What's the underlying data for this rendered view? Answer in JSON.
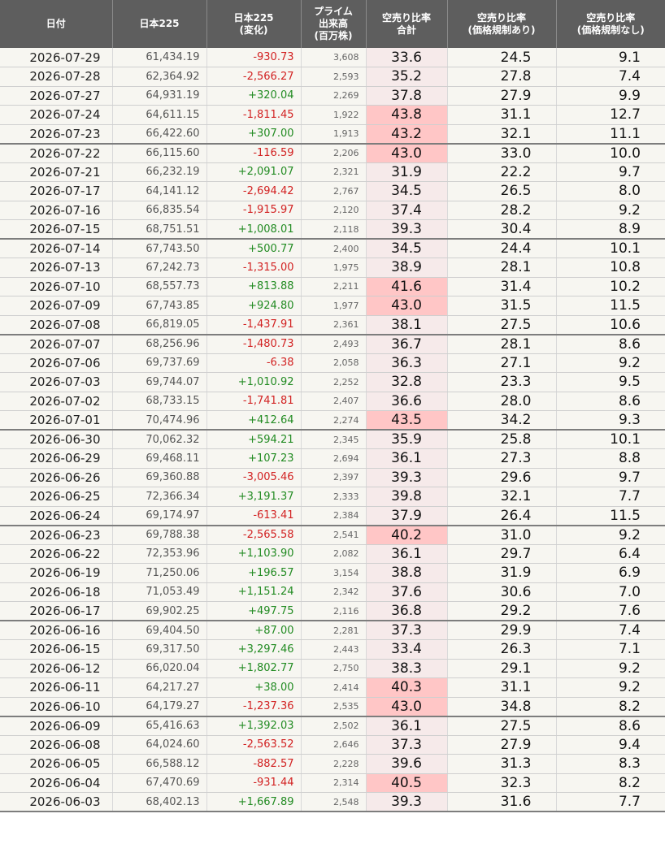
{
  "header": {
    "date": "日付",
    "nikkei": "日本225",
    "change": [
      "日本225",
      "(変化)"
    ],
    "volume": [
      "プライム",
      "出来高",
      "(百万株)"
    ],
    "ratio_total": [
      "空売り比率",
      "合計"
    ],
    "ratio_reg": [
      "空売り比率",
      "(価格規制あり)"
    ],
    "ratio_noreg": [
      "空売り比率",
      "(価格規制なし)"
    ]
  },
  "colors": {
    "negative": "#d22222",
    "positive": "#228b22",
    "highlight": "#ffc6c6",
    "header_bg": "#5e5e5e"
  },
  "highlight_threshold": 40,
  "rows": [
    {
      "date": "2026-07-29",
      "nikkei": "61,434.19",
      "change": "-930.73",
      "volume": "3,608",
      "total": "33.6",
      "reg": "24.5",
      "noreg": "9.1"
    },
    {
      "date": "2026-07-28",
      "nikkei": "62,364.92",
      "change": "-2,566.27",
      "volume": "2,593",
      "total": "35.2",
      "reg": "27.8",
      "noreg": "7.4"
    },
    {
      "date": "2026-07-27",
      "nikkei": "64,931.19",
      "change": "+320.04",
      "volume": "2,269",
      "total": "37.8",
      "reg": "27.9",
      "noreg": "9.9"
    },
    {
      "date": "2026-07-24",
      "nikkei": "64,611.15",
      "change": "-1,811.45",
      "volume": "1,922",
      "total": "43.8",
      "reg": "31.1",
      "noreg": "12.7"
    },
    {
      "date": "2026-07-23",
      "nikkei": "66,422.60",
      "change": "+307.00",
      "volume": "1,913",
      "total": "43.2",
      "reg": "32.1",
      "noreg": "11.1"
    },
    {
      "date": "2026-07-22",
      "nikkei": "66,115.60",
      "change": "-116.59",
      "volume": "2,206",
      "total": "43.0",
      "reg": "33.0",
      "noreg": "10.0"
    },
    {
      "date": "2026-07-21",
      "nikkei": "66,232.19",
      "change": "+2,091.07",
      "volume": "2,321",
      "total": "31.9",
      "reg": "22.2",
      "noreg": "9.7"
    },
    {
      "date": "2026-07-17",
      "nikkei": "64,141.12",
      "change": "-2,694.42",
      "volume": "2,767",
      "total": "34.5",
      "reg": "26.5",
      "noreg": "8.0"
    },
    {
      "date": "2026-07-16",
      "nikkei": "66,835.54",
      "change": "-1,915.97",
      "volume": "2,120",
      "total": "37.4",
      "reg": "28.2",
      "noreg": "9.2"
    },
    {
      "date": "2026-07-15",
      "nikkei": "68,751.51",
      "change": "+1,008.01",
      "volume": "2,118",
      "total": "39.3",
      "reg": "30.4",
      "noreg": "8.9"
    },
    {
      "date": "2026-07-14",
      "nikkei": "67,743.50",
      "change": "+500.77",
      "volume": "2,400",
      "total": "34.5",
      "reg": "24.4",
      "noreg": "10.1"
    },
    {
      "date": "2026-07-13",
      "nikkei": "67,242.73",
      "change": "-1,315.00",
      "volume": "1,975",
      "total": "38.9",
      "reg": "28.1",
      "noreg": "10.8"
    },
    {
      "date": "2026-07-10",
      "nikkei": "68,557.73",
      "change": "+813.88",
      "volume": "2,211",
      "total": "41.6",
      "reg": "31.4",
      "noreg": "10.2"
    },
    {
      "date": "2026-07-09",
      "nikkei": "67,743.85",
      "change": "+924.80",
      "volume": "1,977",
      "total": "43.0",
      "reg": "31.5",
      "noreg": "11.5"
    },
    {
      "date": "2026-07-08",
      "nikkei": "66,819.05",
      "change": "-1,437.91",
      "volume": "2,361",
      "total": "38.1",
      "reg": "27.5",
      "noreg": "10.6"
    },
    {
      "date": "2026-07-07",
      "nikkei": "68,256.96",
      "change": "-1,480.73",
      "volume": "2,493",
      "total": "36.7",
      "reg": "28.1",
      "noreg": "8.6"
    },
    {
      "date": "2026-07-06",
      "nikkei": "69,737.69",
      "change": "-6.38",
      "volume": "2,058",
      "total": "36.3",
      "reg": "27.1",
      "noreg": "9.2"
    },
    {
      "date": "2026-07-03",
      "nikkei": "69,744.07",
      "change": "+1,010.92",
      "volume": "2,252",
      "total": "32.8",
      "reg": "23.3",
      "noreg": "9.5"
    },
    {
      "date": "2026-07-02",
      "nikkei": "68,733.15",
      "change": "-1,741.81",
      "volume": "2,407",
      "total": "36.6",
      "reg": "28.0",
      "noreg": "8.6"
    },
    {
      "date": "2026-07-01",
      "nikkei": "70,474.96",
      "change": "+412.64",
      "volume": "2,274",
      "total": "43.5",
      "reg": "34.2",
      "noreg": "9.3"
    },
    {
      "date": "2026-06-30",
      "nikkei": "70,062.32",
      "change": "+594.21",
      "volume": "2,345",
      "total": "35.9",
      "reg": "25.8",
      "noreg": "10.1"
    },
    {
      "date": "2026-06-29",
      "nikkei": "69,468.11",
      "change": "+107.23",
      "volume": "2,694",
      "total": "36.1",
      "reg": "27.3",
      "noreg": "8.8"
    },
    {
      "date": "2026-06-26",
      "nikkei": "69,360.88",
      "change": "-3,005.46",
      "volume": "2,397",
      "total": "39.3",
      "reg": "29.6",
      "noreg": "9.7"
    },
    {
      "date": "2026-06-25",
      "nikkei": "72,366.34",
      "change": "+3,191.37",
      "volume": "2,333",
      "total": "39.8",
      "reg": "32.1",
      "noreg": "7.7"
    },
    {
      "date": "2026-06-24",
      "nikkei": "69,174.97",
      "change": "-613.41",
      "volume": "2,384",
      "total": "37.9",
      "reg": "26.4",
      "noreg": "11.5"
    },
    {
      "date": "2026-06-23",
      "nikkei": "69,788.38",
      "change": "-2,565.58",
      "volume": "2,541",
      "total": "40.2",
      "reg": "31.0",
      "noreg": "9.2"
    },
    {
      "date": "2026-06-22",
      "nikkei": "72,353.96",
      "change": "+1,103.90",
      "volume": "2,082",
      "total": "36.1",
      "reg": "29.7",
      "noreg": "6.4"
    },
    {
      "date": "2026-06-19",
      "nikkei": "71,250.06",
      "change": "+196.57",
      "volume": "3,154",
      "total": "38.8",
      "reg": "31.9",
      "noreg": "6.9"
    },
    {
      "date": "2026-06-18",
      "nikkei": "71,053.49",
      "change": "+1,151.24",
      "volume": "2,342",
      "total": "37.6",
      "reg": "30.6",
      "noreg": "7.0"
    },
    {
      "date": "2026-06-17",
      "nikkei": "69,902.25",
      "change": "+497.75",
      "volume": "2,116",
      "total": "36.8",
      "reg": "29.2",
      "noreg": "7.6"
    },
    {
      "date": "2026-06-16",
      "nikkei": "69,404.50",
      "change": "+87.00",
      "volume": "2,281",
      "total": "37.3",
      "reg": "29.9",
      "noreg": "7.4"
    },
    {
      "date": "2026-06-15",
      "nikkei": "69,317.50",
      "change": "+3,297.46",
      "volume": "2,443",
      "total": "33.4",
      "reg": "26.3",
      "noreg": "7.1"
    },
    {
      "date": "2026-06-12",
      "nikkei": "66,020.04",
      "change": "+1,802.77",
      "volume": "2,750",
      "total": "38.3",
      "reg": "29.1",
      "noreg": "9.2"
    },
    {
      "date": "2026-06-11",
      "nikkei": "64,217.27",
      "change": "+38.00",
      "volume": "2,414",
      "total": "40.3",
      "reg": "31.1",
      "noreg": "9.2"
    },
    {
      "date": "2026-06-10",
      "nikkei": "64,179.27",
      "change": "-1,237.36",
      "volume": "2,535",
      "total": "43.0",
      "reg": "34.8",
      "noreg": "8.2"
    },
    {
      "date": "2026-06-09",
      "nikkei": "65,416.63",
      "change": "+1,392.03",
      "volume": "2,502",
      "total": "36.1",
      "reg": "27.5",
      "noreg": "8.6"
    },
    {
      "date": "2026-06-08",
      "nikkei": "64,024.60",
      "change": "-2,563.52",
      "volume": "2,646",
      "total": "37.3",
      "reg": "27.9",
      "noreg": "9.4"
    },
    {
      "date": "2026-06-05",
      "nikkei": "66,588.12",
      "change": "-882.57",
      "volume": "2,228",
      "total": "39.6",
      "reg": "31.3",
      "noreg": "8.3"
    },
    {
      "date": "2026-06-04",
      "nikkei": "67,470.69",
      "change": "-931.44",
      "volume": "2,314",
      "total": "40.5",
      "reg": "32.3",
      "noreg": "8.2"
    },
    {
      "date": "2026-06-03",
      "nikkei": "68,402.13",
      "change": "+1,667.89",
      "volume": "2,548",
      "total": "39.3",
      "reg": "31.6",
      "noreg": "7.7"
    }
  ]
}
